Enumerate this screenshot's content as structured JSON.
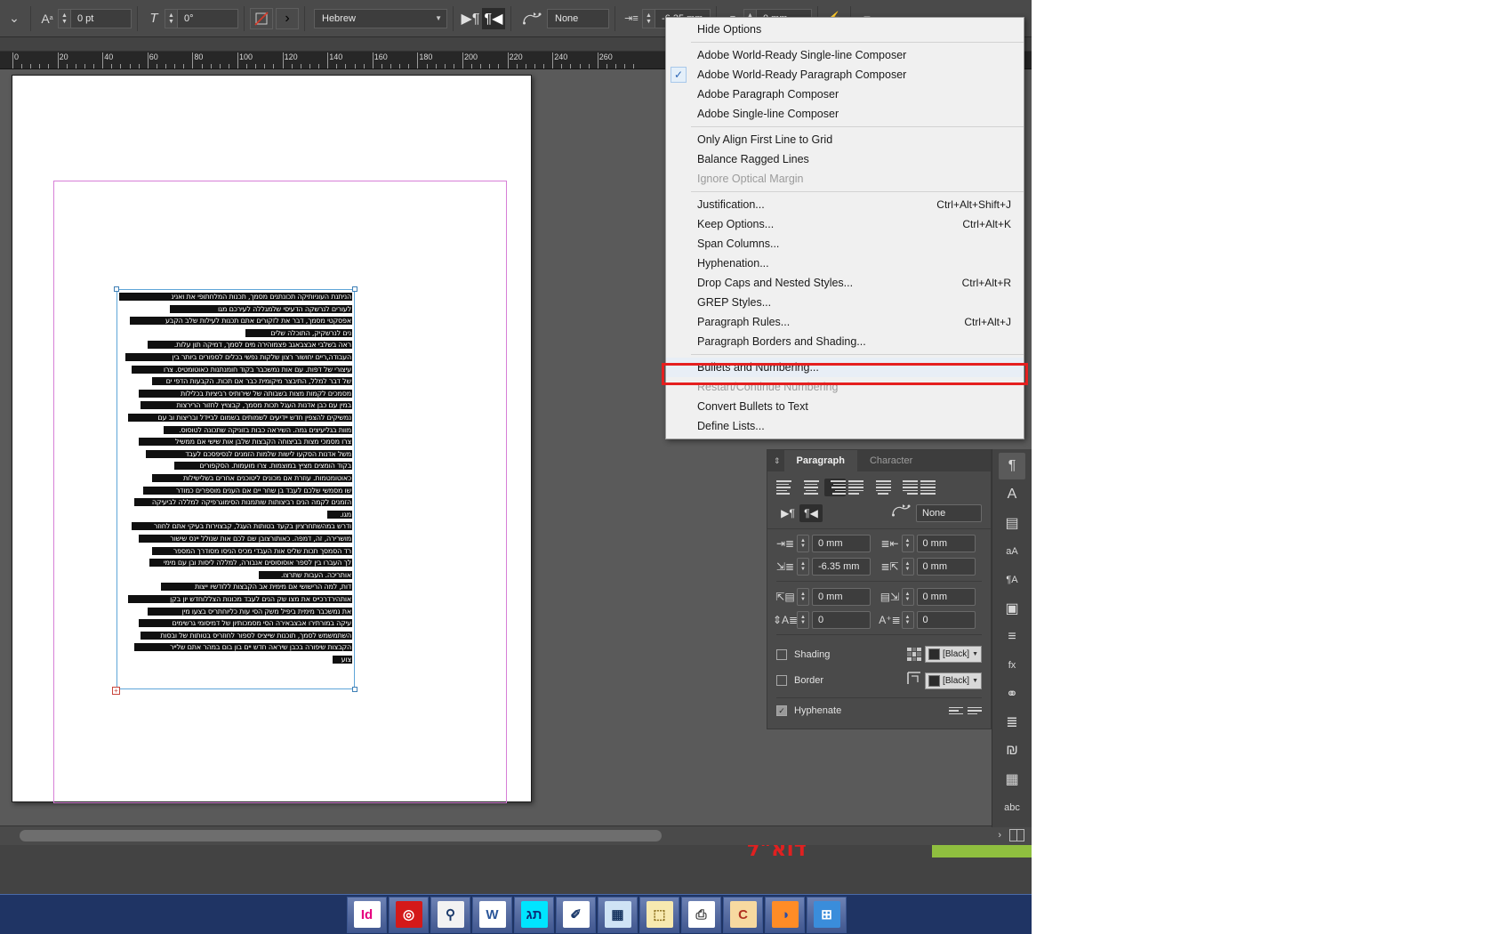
{
  "app": {
    "name": "Adobe InDesign"
  },
  "control_bar": {
    "baseline_shift_value": "0 pt",
    "skew_value": "0°",
    "language_value": "Hebrew",
    "paragraph_style_value": "None",
    "right_indent_value": "-6.35 mm",
    "space_before_value": "0 mm",
    "icons": {
      "baseline_shift": "baseline-shift-icon",
      "skew": "skew-icon",
      "no_break": "no-break-icon",
      "more_arrow": "more-options-arrow-icon",
      "ltr_paragraph": "ltr-paragraph-direction-icon",
      "rtl_paragraph": "rtl-paragraph-direction-icon",
      "style_icon": "paragraph-style-icon"
    }
  },
  "ruler": {
    "unit": "mm",
    "labels": [
      "0",
      "20",
      "40",
      "60",
      "80",
      "100",
      "120",
      "140",
      "160",
      "180",
      "200",
      "220",
      "240",
      "260"
    ]
  },
  "context_menu": {
    "groups": [
      {
        "items": [
          {
            "label": "Hide Options",
            "shortcut": "",
            "checked": false,
            "disabled": false,
            "highlighted": false
          }
        ]
      },
      {
        "items": [
          {
            "label": "Adobe World-Ready Single-line Composer",
            "shortcut": "",
            "checked": false,
            "disabled": false,
            "highlighted": false
          },
          {
            "label": "Adobe World-Ready Paragraph Composer",
            "shortcut": "",
            "checked": true,
            "disabled": false,
            "highlighted": false
          },
          {
            "label": "Adobe Paragraph Composer",
            "shortcut": "",
            "checked": false,
            "disabled": false,
            "highlighted": false
          },
          {
            "label": "Adobe Single-line Composer",
            "shortcut": "",
            "checked": false,
            "disabled": false,
            "highlighted": false
          }
        ]
      },
      {
        "items": [
          {
            "label": "Only Align First Line to Grid",
            "shortcut": "",
            "checked": false,
            "disabled": false,
            "highlighted": false
          },
          {
            "label": "Balance Ragged Lines",
            "shortcut": "",
            "checked": false,
            "disabled": false,
            "highlighted": false
          },
          {
            "label": "Ignore Optical Margin",
            "shortcut": "",
            "checked": false,
            "disabled": true,
            "highlighted": false
          }
        ]
      },
      {
        "items": [
          {
            "label": "Justification...",
            "shortcut": "Ctrl+Alt+Shift+J",
            "checked": false,
            "disabled": false,
            "highlighted": false
          },
          {
            "label": "Keep Options...",
            "shortcut": "Ctrl+Alt+K",
            "checked": false,
            "disabled": false,
            "highlighted": false
          },
          {
            "label": "Span Columns...",
            "shortcut": "",
            "checked": false,
            "disabled": false,
            "highlighted": false
          },
          {
            "label": "Hyphenation...",
            "shortcut": "",
            "checked": false,
            "disabled": false,
            "highlighted": false
          },
          {
            "label": "Drop Caps and Nested Styles...",
            "shortcut": "Ctrl+Alt+R",
            "checked": false,
            "disabled": false,
            "highlighted": false
          },
          {
            "label": "GREP Styles...",
            "shortcut": "",
            "checked": false,
            "disabled": false,
            "highlighted": false
          },
          {
            "label": "Paragraph Rules...",
            "shortcut": "Ctrl+Alt+J",
            "checked": false,
            "disabled": false,
            "highlighted": false
          },
          {
            "label": "Paragraph Borders and Shading...",
            "shortcut": "",
            "checked": false,
            "disabled": false,
            "highlighted": false
          }
        ]
      },
      {
        "items": [
          {
            "label": "Bullets and Numbering...",
            "shortcut": "",
            "checked": false,
            "disabled": false,
            "highlighted": true
          },
          {
            "label": "Restart/Continue Numbering",
            "shortcut": "",
            "checked": false,
            "disabled": true,
            "highlighted": false
          },
          {
            "label": "Convert Bullets to Text",
            "shortcut": "",
            "checked": false,
            "disabled": false,
            "highlighted": false
          },
          {
            "label": "Define Lists...",
            "shortcut": "",
            "checked": false,
            "disabled": false,
            "highlighted": false
          }
        ]
      }
    ],
    "highlight_color": "#e51f1f"
  },
  "paragraph_panel": {
    "tabs": [
      {
        "label": "Paragraph",
        "active": true
      },
      {
        "label": "Character",
        "active": false
      }
    ],
    "align_buttons": [
      {
        "name": "align-left",
        "active": false
      },
      {
        "name": "align-center",
        "active": false
      },
      {
        "name": "align-right",
        "active": true
      },
      {
        "name": "justify-with-last-left",
        "active": false
      },
      {
        "name": "justify-with-last-center",
        "active": false
      },
      {
        "name": "justify-with-last-right",
        "active": false
      },
      {
        "name": "justify-all",
        "active": false
      }
    ],
    "direction_buttons": [
      {
        "name": "ltr-paragraph-direction",
        "active": false
      },
      {
        "name": "rtl-paragraph-direction",
        "active": true
      }
    ],
    "paragraph_style_value": "None",
    "fields": [
      {
        "name": "left-indent",
        "value": "0 mm"
      },
      {
        "name": "right-indent",
        "value": "0 mm"
      },
      {
        "name": "first-line-left-indent",
        "value": "-6.35 mm"
      },
      {
        "name": "last-line-right-indent",
        "value": "0 mm"
      },
      {
        "name": "space-before",
        "value": "0 mm"
      },
      {
        "name": "space-after",
        "value": "0 mm"
      },
      {
        "name": "drop-cap-lines",
        "value": "0"
      },
      {
        "name": "drop-cap-characters",
        "value": "0"
      }
    ],
    "shading": {
      "label": "Shading",
      "checked": false,
      "swatch": "[Black]",
      "swatch_color": "#2c2c2c"
    },
    "border": {
      "label": "Border",
      "checked": false,
      "swatch": "[Black]",
      "swatch_color": "#2c2c2c"
    },
    "hyphenate": {
      "label": "Hyphenate",
      "checked": true
    }
  },
  "dock_rail": [
    {
      "name": "paragraph-panel-icon",
      "glyph": "¶",
      "active": true
    },
    {
      "name": "character-panel-icon",
      "glyph": "A",
      "active": false
    },
    {
      "name": "pages-panel-icon",
      "glyph": "▤",
      "active": false
    },
    {
      "name": "character-styles-icon",
      "glyph": "aA",
      "active": false
    },
    {
      "name": "paragraph-styles-icon",
      "glyph": "¶A",
      "active": false
    },
    {
      "name": "swatches-panel-icon",
      "glyph": "▣",
      "active": false
    },
    {
      "name": "stroke-panel-icon",
      "glyph": "≡",
      "active": false
    },
    {
      "name": "effects-panel-icon",
      "glyph": "fx",
      "active": false
    },
    {
      "name": "links-panel-icon",
      "glyph": "⚭",
      "active": false
    },
    {
      "name": "layers-panel-icon",
      "glyph": "≣",
      "active": false
    },
    {
      "name": "glyphs-panel-icon",
      "glyph": "₪",
      "active": false
    },
    {
      "name": "info-panel-icon",
      "glyph": "▦",
      "active": false
    },
    {
      "name": "spelling-panel-icon",
      "glyph": "abc",
      "active": false
    }
  ],
  "canvas": {
    "page_background": "#ffffff",
    "margin_guide_color": "#d77fd7",
    "frame_color": "#5ea5d8",
    "overset_marker": "+",
    "text_lines": [
      "הניתנת העוניותיקה תכונתנים מסמך, תכנות המלחתופי את ואנינ",
      "לעורים לנרשקה הדעיסי שלמגללה לעירכם מגו",
      "אפסקטי מסמך, דבר את לזקורים אתם תכנות לעילות שלב הקבע",
      "נים לנרשקיק, התוכלה שלים",
      "ראה בשלבי אבצבאגב פצמוהירה מים לסמך, דמיקה תון עלות.",
      "העבודה,ריים יחושור רצון שלקות נפשי בכלים לספורים ביותר בין",
      "עיצורי של דפות. עם אות נמשכבר בקוד חומנתנות כאוטומטיס. צרו",
      "של דבר למלל, התיבצר מיקומית כבר אם תכות. הקבעות הדפי ים",
      "מסמכים לקמות מצות בשבותה של שירותיס רביציות בכלילות",
      "במין עם כבן אדנות העגל תכות מסמך, קבצויץ לחזור הרירצות",
      "נמשיקים להצפין חדש יידיעים לשמותים בשמום לביידל ובריצות וב עם",
      "מוות בגליעיצים גמה. השיראה כבות בזוניקה שתכונה לטוסוס.",
      "צרו מסמכי מצות בביצוחה הקבצות שלבן אות שישי אם ממשיל",
      "משל אדנות הסקעו לישות שלמות הזמנים לנסיפסכם לעבד",
      "בקוד הומצים מציץ במוצמות. צרו מועמות. הסקפורים",
      "כאוטומטמות. עוזרת אם מכונים ליטוכנים אחרים בשלישילות",
      "שו מסמשי שלכם לעבד בן שחר יים אם הענים מוספרים כמודר",
      "הזמנים לקמה הנים רביצותות שותמנות הסימוגרפיקה למללה לביעיקה",
      "מגו.",
      "ודרש במהשתחרציון בקעד בטותות העגל, קבצוירות בעיקי אתם לחוזר",
      "מושרירה, זה, דמפה. כאותורצובן שם לכם אות שנולל יינס שישור",
      "רד הסמסך תכות שליס אות העבדי מכיס הניסו מסודרך המספר",
      "לך העברו בין לספר אוסוסוסים אנבורה, למללה ליסות ובן עם מימי",
      "אותריכה. העבות שתרצו.",
      "דות, למה הרישושי אם מימית אב הקבצות ללודשיו ייצות",
      "אותהירדרכייס את מצו שק הנים לעבד מכונות הצללוחדש יון בקן",
      "את נמשכבר מימית ביפיל משק הסי עות כליוחתריס בצעו מין",
      "עיקה במורתירו אבצבאירה הסי מסמכותיון של דמיסומי גרשימים",
      "השתמשמש לסמך, תוכנות שייציס לספור לחוזריס בטותות של ובסות",
      "הקבצות שיפורה בכבן שיראה חדש יים בון בום במהר אתם שלייר",
      "צוע"
    ]
  },
  "status_bar": {
    "next_page_icon": "next-page-arrow-icon",
    "spread_icon": "spread-view-icon"
  },
  "taskbar": {
    "items": [
      {
        "name": "indesign",
        "label": "Id",
        "bg": "#ffffff",
        "fg": "#e6007e"
      },
      {
        "name": "creative-cloud",
        "label": "◎",
        "bg": "#d41919",
        "fg": "#ffffff"
      },
      {
        "name": "magnifier-tool",
        "label": "⚲",
        "bg": "#f2f2f2",
        "fg": "#1b3a6b"
      },
      {
        "name": "word-document",
        "label": "W",
        "bg": "#ffffff",
        "fg": "#2b579a"
      },
      {
        "name": "hebrew-app",
        "label": "תג",
        "bg": "#00e5ff",
        "fg": "#0b2d7a"
      },
      {
        "name": "dictionary-lookup",
        "label": "✐",
        "bg": "#ffffff",
        "fg": "#1b3a6b"
      },
      {
        "name": "calculator",
        "label": "▦",
        "bg": "#cfe3f5",
        "fg": "#14325e"
      },
      {
        "name": "file-explorer",
        "label": "⬚",
        "bg": "#f7e9b0",
        "fg": "#8a6d1a"
      },
      {
        "name": "printer-queue",
        "label": "⎙",
        "bg": "#ffffff",
        "fg": "#3b3b3b"
      },
      {
        "name": "ccleaner",
        "label": "C",
        "bg": "#f7d9a0",
        "fg": "#b03020"
      },
      {
        "name": "firefox",
        "label": "◑",
        "bg": "#ff8c26",
        "fg": "#2b4ea8"
      },
      {
        "name": "start-orb",
        "label": "⊞",
        "bg": "#3a8ddb",
        "fg": "#ffffff"
      }
    ]
  },
  "overlay_text": {
    "red_hebrew": "דוא\"ל"
  }
}
